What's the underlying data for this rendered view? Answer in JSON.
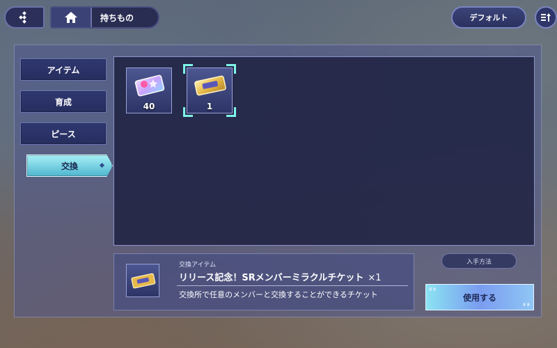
{
  "header": {
    "page_title": "持ちもの",
    "default_label": "デフォルト"
  },
  "tabs": [
    {
      "label": "アイテム",
      "active": false
    },
    {
      "label": "育成",
      "active": false
    },
    {
      "label": "ピース",
      "active": false
    },
    {
      "label": "交換",
      "active": true
    }
  ],
  "inventory": {
    "items": [
      {
        "icon": "crystal-ticket-icon",
        "count": "40",
        "selected": false
      },
      {
        "icon": "gold-ticket-icon",
        "count": "1",
        "selected": true
      }
    ]
  },
  "detail": {
    "tag": "交換アイテム",
    "name": "リリース記念！SRメンバーミラクルチケット",
    "quantity": "×1",
    "description": "交換所で任意のメンバーと交換することができるチケット"
  },
  "actions": {
    "obtain_label": "入手方法",
    "use_label": "使用する"
  },
  "colors": {
    "accent": "#7ff4e8",
    "panel": "#2a2d52",
    "active_tab": "#4fb6cf"
  }
}
